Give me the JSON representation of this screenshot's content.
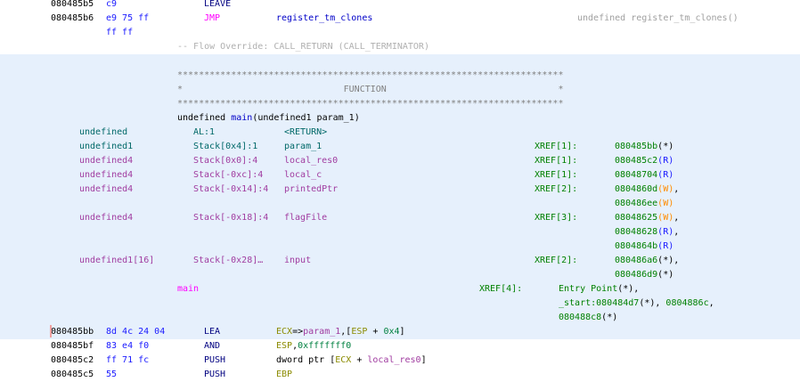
{
  "colors": {
    "highlight_bg": "#e6f0fc",
    "xref_green": "#008000",
    "read_blue": "#1a1aff",
    "write_orange": "#ff8c00"
  },
  "lines": [
    {
      "name": "instruction-leave",
      "cells": [
        {
          "col": "addr",
          "parts": [
            {
              "t": "080485b5",
              "k": "addr"
            }
          ]
        },
        {
          "col": "bytes",
          "parts": [
            {
              "t": "c9",
              "k": "bytes"
            }
          ]
        },
        {
          "col": "mnem",
          "parts": [
            {
              "t": "LEAVE",
              "k": "mnem"
            }
          ]
        }
      ]
    },
    {
      "name": "instruction-jmp",
      "cells": [
        {
          "col": "addr",
          "parts": [
            {
              "t": "080485b6",
              "k": "addr"
            }
          ]
        },
        {
          "col": "bytes",
          "parts": [
            {
              "t": "e9 75 ff",
              "k": "bytes"
            }
          ]
        },
        {
          "col": "mnem",
          "parts": [
            {
              "t": "JMP",
              "k": "jmp"
            }
          ]
        },
        {
          "col": "op",
          "parts": [
            {
              "t": "register_tm_clones",
              "k": "fn"
            }
          ]
        },
        {
          "col": "cmt",
          "parts": [
            {
              "t": "undefined register_tm_clones()",
              "k": "cmt"
            }
          ]
        }
      ]
    },
    {
      "name": "instruction-bytes-cont",
      "cells": [
        {
          "col": "bytes",
          "parts": [
            {
              "t": "ff ff",
              "k": "bytes"
            }
          ]
        }
      ]
    },
    {
      "name": "flow-override",
      "cells": [
        {
          "col": "flow",
          "parts": [
            {
              "t": "-- Flow Override: CALL_RETURN (CALL_TERMINATOR)",
              "k": "flow"
            }
          ]
        }
      ]
    },
    {
      "name": "blank",
      "cells": []
    },
    {
      "name": "function-banner-top",
      "cells": [
        {
          "col": "flow",
          "parts": [
            {
              "t": "************************************************************************",
              "k": "star"
            }
          ]
        }
      ]
    },
    {
      "name": "function-banner-title",
      "cells": [
        {
          "col": "flow",
          "parts": [
            {
              "t": "*                              FUNCTION                                *",
              "k": "star"
            }
          ]
        }
      ]
    },
    {
      "name": "function-banner-bottom",
      "cells": [
        {
          "col": "flow",
          "parts": [
            {
              "t": "************************************************************************",
              "k": "star"
            }
          ]
        }
      ]
    },
    {
      "name": "function-signature",
      "cells": [
        {
          "col": "flow",
          "parts": [
            {
              "t": "undefined ",
              "k": "plain"
            },
            {
              "t": "main",
              "k": "fn"
            },
            {
              "t": "(undefined1 param_1)",
              "k": "plain"
            }
          ]
        }
      ]
    },
    {
      "name": "var-return",
      "cells": [
        {
          "col": "vtype",
          "parts": [
            {
              "t": "undefined",
              "k": "teal"
            }
          ]
        },
        {
          "col": "vstor",
          "parts": [
            {
              "t": "AL:1",
              "k": "teal"
            }
          ]
        },
        {
          "col": "vname",
          "parts": [
            {
              "t": "<RETURN>",
              "k": "teal"
            }
          ]
        }
      ]
    },
    {
      "name": "var-param-1",
      "cells": [
        {
          "col": "vtype",
          "parts": [
            {
              "t": "undefined1",
              "k": "teal"
            }
          ]
        },
        {
          "col": "vstor",
          "parts": [
            {
              "t": "Stack[0x4]:1",
              "k": "teal"
            }
          ]
        },
        {
          "col": "vname",
          "parts": [
            {
              "t": "param_1",
              "k": "teal"
            }
          ]
        },
        {
          "col": "xref",
          "parts": [
            {
              "t": "XREF[1]:",
              "k": "green"
            }
          ]
        },
        {
          "col": "xval",
          "parts": [
            {
              "t": "080485bb",
              "k": "green"
            },
            {
              "t": "(*)",
              "k": "plain"
            }
          ]
        }
      ]
    },
    {
      "name": "var-local-res0",
      "cells": [
        {
          "col": "vtype",
          "parts": [
            {
              "t": "undefined4",
              "k": "purple"
            }
          ]
        },
        {
          "col": "vstor",
          "parts": [
            {
              "t": "Stack[0x0]:4",
              "k": "purple"
            }
          ]
        },
        {
          "col": "vname",
          "parts": [
            {
              "t": "local_res0",
              "k": "purple"
            }
          ]
        },
        {
          "col": "xref",
          "parts": [
            {
              "t": "XREF[1]:",
              "k": "green"
            }
          ]
        },
        {
          "col": "xval",
          "parts": [
            {
              "t": "080485c2",
              "k": "green"
            },
            {
              "t": "(R)",
              "k": "r"
            }
          ]
        }
      ]
    },
    {
      "name": "var-local-c",
      "cells": [
        {
          "col": "vtype",
          "parts": [
            {
              "t": "undefined4",
              "k": "purple"
            }
          ]
        },
        {
          "col": "vstor",
          "parts": [
            {
              "t": "Stack[-0xc]:4",
              "k": "purple"
            }
          ]
        },
        {
          "col": "vname",
          "parts": [
            {
              "t": "local_c",
              "k": "purple"
            }
          ]
        },
        {
          "col": "xref",
          "parts": [
            {
              "t": "XREF[1]:",
              "k": "green"
            }
          ]
        },
        {
          "col": "xval",
          "parts": [
            {
              "t": "08048704",
              "k": "green"
            },
            {
              "t": "(R)",
              "k": "r"
            }
          ]
        }
      ]
    },
    {
      "name": "var-printedptr",
      "cells": [
        {
          "col": "vtype",
          "parts": [
            {
              "t": "undefined4",
              "k": "purple"
            }
          ]
        },
        {
          "col": "vstor",
          "parts": [
            {
              "t": "Stack[-0x14]:4",
              "k": "purple"
            }
          ]
        },
        {
          "col": "vname",
          "parts": [
            {
              "t": "printedPtr",
              "k": "purple"
            }
          ]
        },
        {
          "col": "xref",
          "parts": [
            {
              "t": "XREF[2]:",
              "k": "green"
            }
          ]
        },
        {
          "col": "xval",
          "parts": [
            {
              "t": "0804860d",
              "k": "green"
            },
            {
              "t": "(W)",
              "k": "w"
            },
            {
              "t": ",",
              "k": "plain"
            }
          ]
        }
      ]
    },
    {
      "name": "xref-cont",
      "cells": [
        {
          "col": "xval",
          "parts": [
            {
              "t": "080486ee",
              "k": "green"
            },
            {
              "t": "(W)",
              "k": "w"
            }
          ]
        }
      ]
    },
    {
      "name": "var-flagfile",
      "cells": [
        {
          "col": "vtype",
          "parts": [
            {
              "t": "undefined4",
              "k": "purple"
            }
          ]
        },
        {
          "col": "vstor",
          "parts": [
            {
              "t": "Stack[-0x18]:4",
              "k": "purple"
            }
          ]
        },
        {
          "col": "vname",
          "parts": [
            {
              "t": "flagFile",
              "k": "purple"
            }
          ]
        },
        {
          "col": "xref",
          "parts": [
            {
              "t": "XREF[3]:",
              "k": "green"
            }
          ]
        },
        {
          "col": "xval",
          "parts": [
            {
              "t": "08048625",
              "k": "green"
            },
            {
              "t": "(W)",
              "k": "w"
            },
            {
              "t": ",",
              "k": "plain"
            }
          ]
        }
      ]
    },
    {
      "name": "xref-cont",
      "cells": [
        {
          "col": "xval",
          "parts": [
            {
              "t": "08048628",
              "k": "green"
            },
            {
              "t": "(R)",
              "k": "r"
            },
            {
              "t": ",",
              "k": "plain"
            }
          ]
        }
      ]
    },
    {
      "name": "xref-cont",
      "cells": [
        {
          "col": "xval",
          "parts": [
            {
              "t": "0804864b",
              "k": "green"
            },
            {
              "t": "(R)",
              "k": "r"
            }
          ]
        }
      ]
    },
    {
      "name": "var-input",
      "cells": [
        {
          "col": "vtype",
          "parts": [
            {
              "t": "undefined1[16]",
              "k": "purple"
            }
          ]
        },
        {
          "col": "vstor",
          "parts": [
            {
              "t": "Stack[-0x28]…",
              "k": "purple"
            }
          ]
        },
        {
          "col": "vname",
          "parts": [
            {
              "t": "input",
              "k": "purple"
            }
          ]
        },
        {
          "col": "xref",
          "parts": [
            {
              "t": "XREF[2]:",
              "k": "green"
            }
          ]
        },
        {
          "col": "xval",
          "parts": [
            {
              "t": "080486a6",
              "k": "green"
            },
            {
              "t": "(*),",
              "k": "plain"
            }
          ]
        }
      ]
    },
    {
      "name": "xref-cont",
      "cells": [
        {
          "col": "xval",
          "parts": [
            {
              "t": "080486d9",
              "k": "green"
            },
            {
              "t": "(*)",
              "k": "plain"
            }
          ]
        }
      ]
    },
    {
      "name": "label-main",
      "cells": [
        {
          "col": "label",
          "parts": [
            {
              "t": "main",
              "k": "label"
            }
          ]
        },
        {
          "col": "lxref",
          "parts": [
            {
              "t": "XREF[4]:",
              "k": "green"
            }
          ]
        },
        {
          "col": "lxval",
          "parts": [
            {
              "t": "Entry Point",
              "k": "green"
            },
            {
              "t": "(*),",
              "k": "plain"
            }
          ]
        }
      ]
    },
    {
      "name": "xref-cont",
      "cells": [
        {
          "col": "lxval",
          "parts": [
            {
              "t": "_start:080484d7",
              "k": "green"
            },
            {
              "t": "(*), ",
              "k": "plain"
            },
            {
              "t": "0804886c",
              "k": "green"
            },
            {
              "t": ",",
              "k": "plain"
            }
          ]
        }
      ]
    },
    {
      "name": "xref-cont",
      "cells": [
        {
          "col": "lxval",
          "parts": [
            {
              "t": "080488c8",
              "k": "green"
            },
            {
              "t": "(*)",
              "k": "plain"
            }
          ]
        }
      ]
    },
    {
      "name": "instruction-lea",
      "cells": [
        {
          "col": "addr",
          "parts": [
            {
              "t": "080485bb",
              "k": "addr"
            }
          ]
        },
        {
          "col": "bytes",
          "parts": [
            {
              "t": "8d 4c 24 04",
              "k": "bytes"
            }
          ]
        },
        {
          "col": "mnem",
          "parts": [
            {
              "t": "LEA",
              "k": "mnem"
            }
          ]
        },
        {
          "col": "op",
          "parts": [
            {
              "t": "ECX",
              "k": "reg"
            },
            {
              "t": "=>",
              "k": "plain"
            },
            {
              "t": "param_1",
              "k": "purple"
            },
            {
              "t": ",[",
              "k": "plain"
            },
            {
              "t": "ESP",
              "k": "reg"
            },
            {
              "t": " + ",
              "k": "plain"
            },
            {
              "t": "0x4",
              "k": "num"
            },
            {
              "t": "]",
              "k": "plain"
            }
          ]
        }
      ]
    },
    {
      "name": "instruction-and",
      "cells": [
        {
          "col": "addr",
          "parts": [
            {
              "t": "080485bf",
              "k": "addr"
            }
          ]
        },
        {
          "col": "bytes",
          "parts": [
            {
              "t": "83 e4 f0",
              "k": "bytes"
            }
          ]
        },
        {
          "col": "mnem",
          "parts": [
            {
              "t": "AND",
              "k": "mnem"
            }
          ]
        },
        {
          "col": "op",
          "parts": [
            {
              "t": "ESP",
              "k": "reg"
            },
            {
              "t": ",",
              "k": "plain"
            },
            {
              "t": "0xfffffff0",
              "k": "num"
            }
          ]
        }
      ]
    },
    {
      "name": "instruction-push",
      "cells": [
        {
          "col": "addr",
          "parts": [
            {
              "t": "080485c2",
              "k": "addr"
            }
          ]
        },
        {
          "col": "bytes",
          "parts": [
            {
              "t": "ff 71 fc",
              "k": "bytes"
            }
          ]
        },
        {
          "col": "mnem",
          "parts": [
            {
              "t": "PUSH",
              "k": "mnem"
            }
          ]
        },
        {
          "col": "op",
          "parts": [
            {
              "t": "dword ptr [",
              "k": "plain"
            },
            {
              "t": "ECX",
              "k": "reg"
            },
            {
              "t": " + ",
              "k": "plain"
            },
            {
              "t": "local_res0",
              "k": "purple"
            },
            {
              "t": "]",
              "k": "plain"
            }
          ]
        }
      ]
    },
    {
      "name": "instruction-push",
      "cells": [
        {
          "col": "addr",
          "parts": [
            {
              "t": "080485c5",
              "k": "addr"
            }
          ]
        },
        {
          "col": "bytes",
          "parts": [
            {
              "t": "55",
              "k": "bytes"
            }
          ]
        },
        {
          "col": "mnem",
          "parts": [
            {
              "t": "PUSH",
              "k": "mnem"
            }
          ]
        },
        {
          "col": "op",
          "parts": [
            {
              "t": "EBP",
              "k": "reg"
            }
          ]
        }
      ]
    }
  ]
}
